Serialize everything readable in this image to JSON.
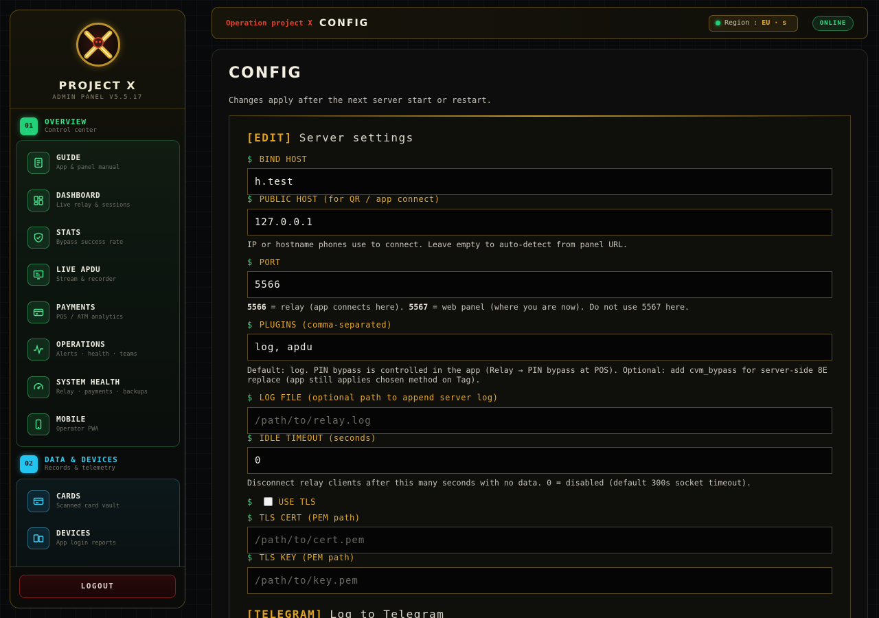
{
  "brand": {
    "title": "PROJECT X",
    "subtitle": "ADMIN PANEL V5.5.17"
  },
  "sidebar": {
    "sections": [
      {
        "badge": "01",
        "title": "OVERVIEW",
        "subtitle": "Control center",
        "items": [
          {
            "label": "GUIDE",
            "sub": "App & panel manual",
            "icon": "book-icon"
          },
          {
            "label": "DASHBOARD",
            "sub": "Live relay & sessions",
            "icon": "dashboard-icon"
          },
          {
            "label": "STATS",
            "sub": "Bypass success rate",
            "icon": "shield-check-icon"
          },
          {
            "label": "LIVE APDU",
            "sub": "Stream & recorder",
            "icon": "monitor-icon"
          },
          {
            "label": "PAYMENTS",
            "sub": "POS / ATM analytics",
            "icon": "card-terminal-icon"
          },
          {
            "label": "OPERATIONS",
            "sub": "Alerts · health · teams",
            "icon": "pulse-icon"
          },
          {
            "label": "SYSTEM HEALTH",
            "sub": "Relay · payments · backups",
            "icon": "gauge-icon"
          },
          {
            "label": "MOBILE",
            "sub": "Operator PWA",
            "icon": "phone-icon"
          }
        ]
      },
      {
        "badge": "02",
        "title": "DATA & DEVICES",
        "subtitle": "Records & telemetry",
        "items": [
          {
            "label": "CARDS",
            "sub": "Scanned card vault",
            "icon": "credit-card-icon"
          },
          {
            "label": "DEVICES",
            "sub": "App login reports",
            "icon": "devices-icon"
          }
        ]
      }
    ],
    "logout": "LOGOUT"
  },
  "topbar": {
    "crumb_parent": "Operation project X",
    "crumb_current": "CONFIG",
    "region_label": "Region :",
    "region_value": "EU · s",
    "status": "ONLINE"
  },
  "page": {
    "title": "CONFIG",
    "description": "Changes apply after the next server start or restart."
  },
  "server_settings": {
    "tag": "[EDIT]",
    "title": "Server settings",
    "prompt": "$",
    "fields": {
      "bind_host": {
        "label": "BIND HOST",
        "value": "h.test"
      },
      "public_host": {
        "label": "PUBLIC HOST (for QR / app connect)",
        "value": "127.0.0.1",
        "help": "IP or hostname phones use to connect. Leave empty to auto-detect from panel URL."
      },
      "port": {
        "label": "PORT",
        "value": "5566",
        "help_a": "5566",
        "help_b": " = relay (app connects here). ",
        "help_c": "5567",
        "help_d": " = web panel (where you are now). Do not use 5567 here."
      },
      "plugins": {
        "label": "PLUGINS (comma-separated)",
        "value": "log, apdu",
        "help": "Default: log. PIN bypass is controlled in the app (Relay → PIN bypass at POS). Optional: add cvm_bypass for server-side 8E replace (app still applies chosen method on Tag)."
      },
      "log_file": {
        "label": "LOG FILE (optional path to append server log)",
        "value": "",
        "placeholder": "/path/to/relay.log"
      },
      "idle_timeout": {
        "label": "IDLE TIMEOUT (seconds)",
        "value": "0",
        "help": "Disconnect relay clients after this many seconds with no data. 0 = disabled (default 300s socket timeout)."
      },
      "use_tls": {
        "label": "USE TLS",
        "checked": false
      },
      "tls_cert": {
        "label": "TLS CERT (PEM path)",
        "value": "",
        "placeholder": "/path/to/cert.pem"
      },
      "tls_key": {
        "label": "TLS KEY (PEM path)",
        "value": "",
        "placeholder": "/path/to/key.pem"
      }
    }
  },
  "telegram": {
    "tag": "[TELEGRAM]",
    "title": "Log to Telegram"
  },
  "colors": {
    "accent": "#e0a020",
    "green": "#34e08a",
    "cyan": "#34cdf2",
    "danger": "#e0402e"
  }
}
